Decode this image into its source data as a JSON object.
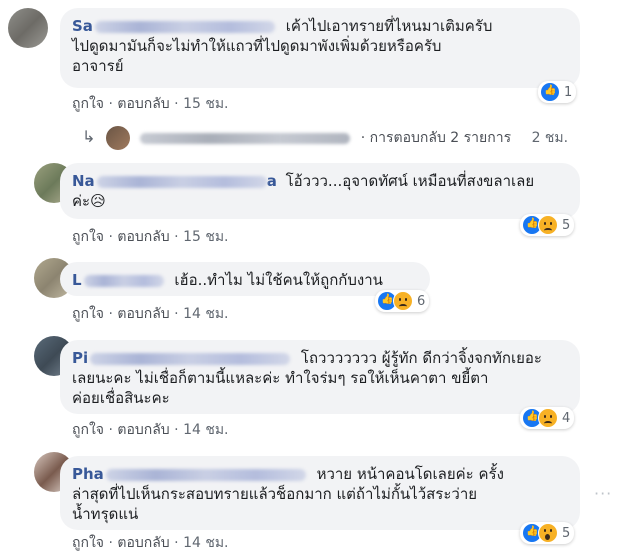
{
  "comments": [
    {
      "name_prefix": "Sa",
      "text_line1": "เค้าไปเอาทรายที่ไหนมาเติมครับ",
      "text_line2": "ไปดูดมามันก็จะไม่ทำให้แถวที่ไปดูดมาพังเพิ่มด้วยหรือครับ",
      "text_line3": "อาจารย์",
      "like_label": "ถูกใจ",
      "reply_label": "ตอบกลับ",
      "time": "15 ชม.",
      "react_count": "1",
      "reply_summary": {
        "label": "การตอบกลับ 2 รายการ",
        "time": "2 ชม."
      }
    },
    {
      "name_prefix": "Na",
      "name_suffix": "a",
      "text_line1": "โอ้ววว...อุจาดทัศน์ เหมือนที่สงขลาเลย",
      "text_line2": "ค่ะ😥",
      "like_label": "ถูกใจ",
      "reply_label": "ตอบกลับ",
      "time": "15 ชม.",
      "react_count": "5"
    },
    {
      "name_prefix": "L",
      "text_line1": "เฮ้อ..ทำไม ไม่ใช้คนให้ถูกกับงาน",
      "like_label": "ถูกใจ",
      "reply_label": "ตอบกลับ",
      "time": "14 ชม.",
      "react_count": "6"
    },
    {
      "name_prefix": "Pi",
      "text_line1": "โถววววววว ผู้รู้ทัก ดีกว่าจิ้งจกทักเยอะ",
      "text_line2": "เลยนะคะ ไม่เชื่อก็ตามนี้แหละค่ะ ทำใจร่มๆ รอให้เห็นคาตา ขยี้ตา",
      "text_line3": "ค่อยเชื่อสินะคะ",
      "like_label": "ถูกใจ",
      "reply_label": "ตอบกลับ",
      "time": "14 ชม.",
      "react_count": "4"
    },
    {
      "name_prefix": "Pha",
      "text_line1": "หวาย หน้าคอนโดเลยค่ะ ครั้ง",
      "text_line2": "ล่าสุดที่ไปเห็นกระสอบทรายแล้วช็อกมาก แต่ถ้าไม่กั้นไว้สระว่าย",
      "text_line3": "น้ำทรุดแน่",
      "like_label": "ถูกใจ",
      "reply_label": "ตอบกลับ",
      "time": "14 ชม.",
      "react_count": "5"
    }
  ],
  "separator": "·",
  "reply_arrow": "↳",
  "menu_dots": "···"
}
